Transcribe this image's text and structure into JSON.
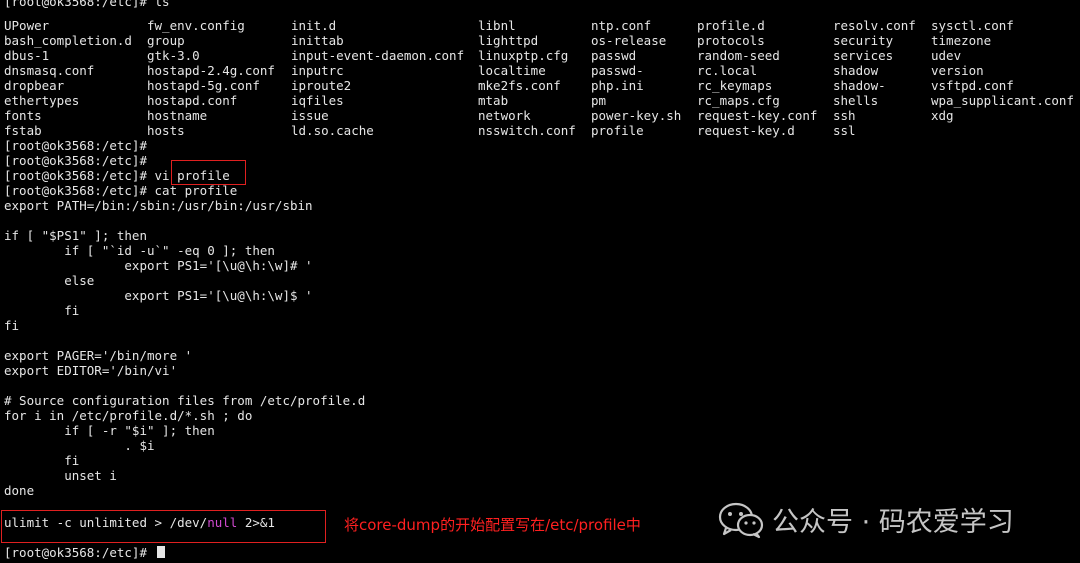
{
  "terminal": {
    "prompt": "[root@ok3568:/etc]#",
    "top_partial_line": "[root@ok3568:/etc]# ls",
    "ls_rows": [
      [
        "UPower",
        "fw_env.config",
        "init.d",
        "libnl",
        "ntp.conf",
        "profile.d",
        "resolv.conf",
        "sysctl.conf"
      ],
      [
        "bash_completion.d",
        "group",
        "inittab",
        "lighttpd",
        "os-release",
        "protocols",
        "security",
        "timezone"
      ],
      [
        "dbus-1",
        "gtk-3.0",
        "input-event-daemon.conf",
        "linuxptp.cfg",
        "passwd",
        "random-seed",
        "services",
        "udev"
      ],
      [
        "dnsmasq.conf",
        "hostapd-2.4g.conf",
        "inputrc",
        "localtime",
        "passwd-",
        "rc.local",
        "shadow",
        "version"
      ],
      [
        "dropbear",
        "hostapd-5g.conf",
        "iproute2",
        "mke2fs.conf",
        "php.ini",
        "rc_keymaps",
        "shadow-",
        "vsftpd.conf"
      ],
      [
        "ethertypes",
        "hostapd.conf",
        "iqfiles",
        "mtab",
        "pm",
        "rc_maps.cfg",
        "shells",
        "wpa_supplicant.conf"
      ],
      [
        "fonts",
        "hostname",
        "issue",
        "network",
        "power-key.sh",
        "request-key.conf",
        "ssh",
        "xdg"
      ],
      [
        "fstab",
        "hosts",
        "ld.so.cache",
        "nsswitch.conf",
        "profile",
        "request-key.d",
        "ssl",
        ""
      ]
    ],
    "lines": [
      "[root@ok3568:/etc]#",
      "[root@ok3568:/etc]#",
      "[root@ok3568:/etc]# vi profile",
      "[root@ok3568:/etc]# cat profile",
      "export PATH=/bin:/sbin:/usr/bin:/usr/sbin",
      "",
      "if [ \"$PS1\" ]; then",
      "        if [ \"`id -u`\" -eq 0 ]; then",
      "                export PS1='[\\u@\\h:\\w]# '",
      "        else",
      "                export PS1='[\\u@\\h:\\w]$ '",
      "        fi",
      "fi",
      "",
      "export PAGER='/bin/more '",
      "export EDITOR='/bin/vi'",
      "",
      "# Source configuration files from /etc/profile.d",
      "for i in /etc/profile.d/*.sh ; do",
      "        if [ -r \"$i\" ]; then",
      "                . $i",
      "        fi",
      "        unset i",
      "done"
    ],
    "ulimit_prefix": "ulimit -c unlimited > /dev/",
    "ulimit_null": "null",
    "ulimit_suffix": " 2>&1",
    "last_prompt": "[root@ok3568:/etc]# ",
    "colors": {
      "background": "#000000",
      "text": "#e6e6e6",
      "highlight": "#d14ad1",
      "annotation_red": "#ff2020"
    }
  },
  "annotation": "将core-dump的开始配置写在/etc/profile中",
  "watermark": {
    "text": "公众号 · 码农爱学习",
    "icon": "wechat-icon"
  }
}
